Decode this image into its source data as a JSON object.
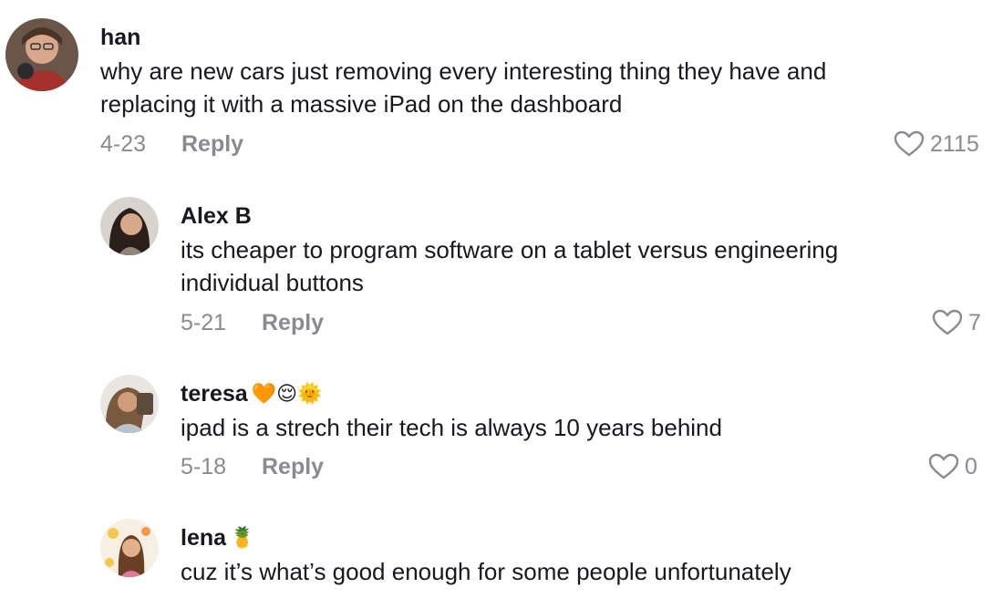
{
  "comments": [
    {
      "username": "han",
      "emoji": "",
      "text_lines": [
        "why are new cars just removing every interesting thing they have and",
        "replacing it with a massive iPad on the dashboard"
      ],
      "date": "4-23",
      "reply_label": "Reply",
      "likes": "2115"
    },
    {
      "username": "Alex B",
      "emoji": "",
      "text_lines": [
        "its cheaper to program software on a tablet versus engineering",
        "individual buttons"
      ],
      "date": "5-21",
      "reply_label": "Reply",
      "likes": "7"
    },
    {
      "username": "teresa",
      "emoji": "🧡😌🌞",
      "text_lines": [
        "ipad is a strech their tech is always 10 years behind"
      ],
      "date": "5-18",
      "reply_label": "Reply",
      "likes": "0"
    },
    {
      "username": "lena",
      "emoji": "🍍",
      "text_lines": [
        "cuz it’s what’s good enough for some people unfortunately"
      ]
    }
  ],
  "colors": {
    "text": "#161823",
    "muted": "#8a8b91",
    "background": "#ffffff"
  },
  "icons": {
    "like": "heart-outline-icon"
  }
}
